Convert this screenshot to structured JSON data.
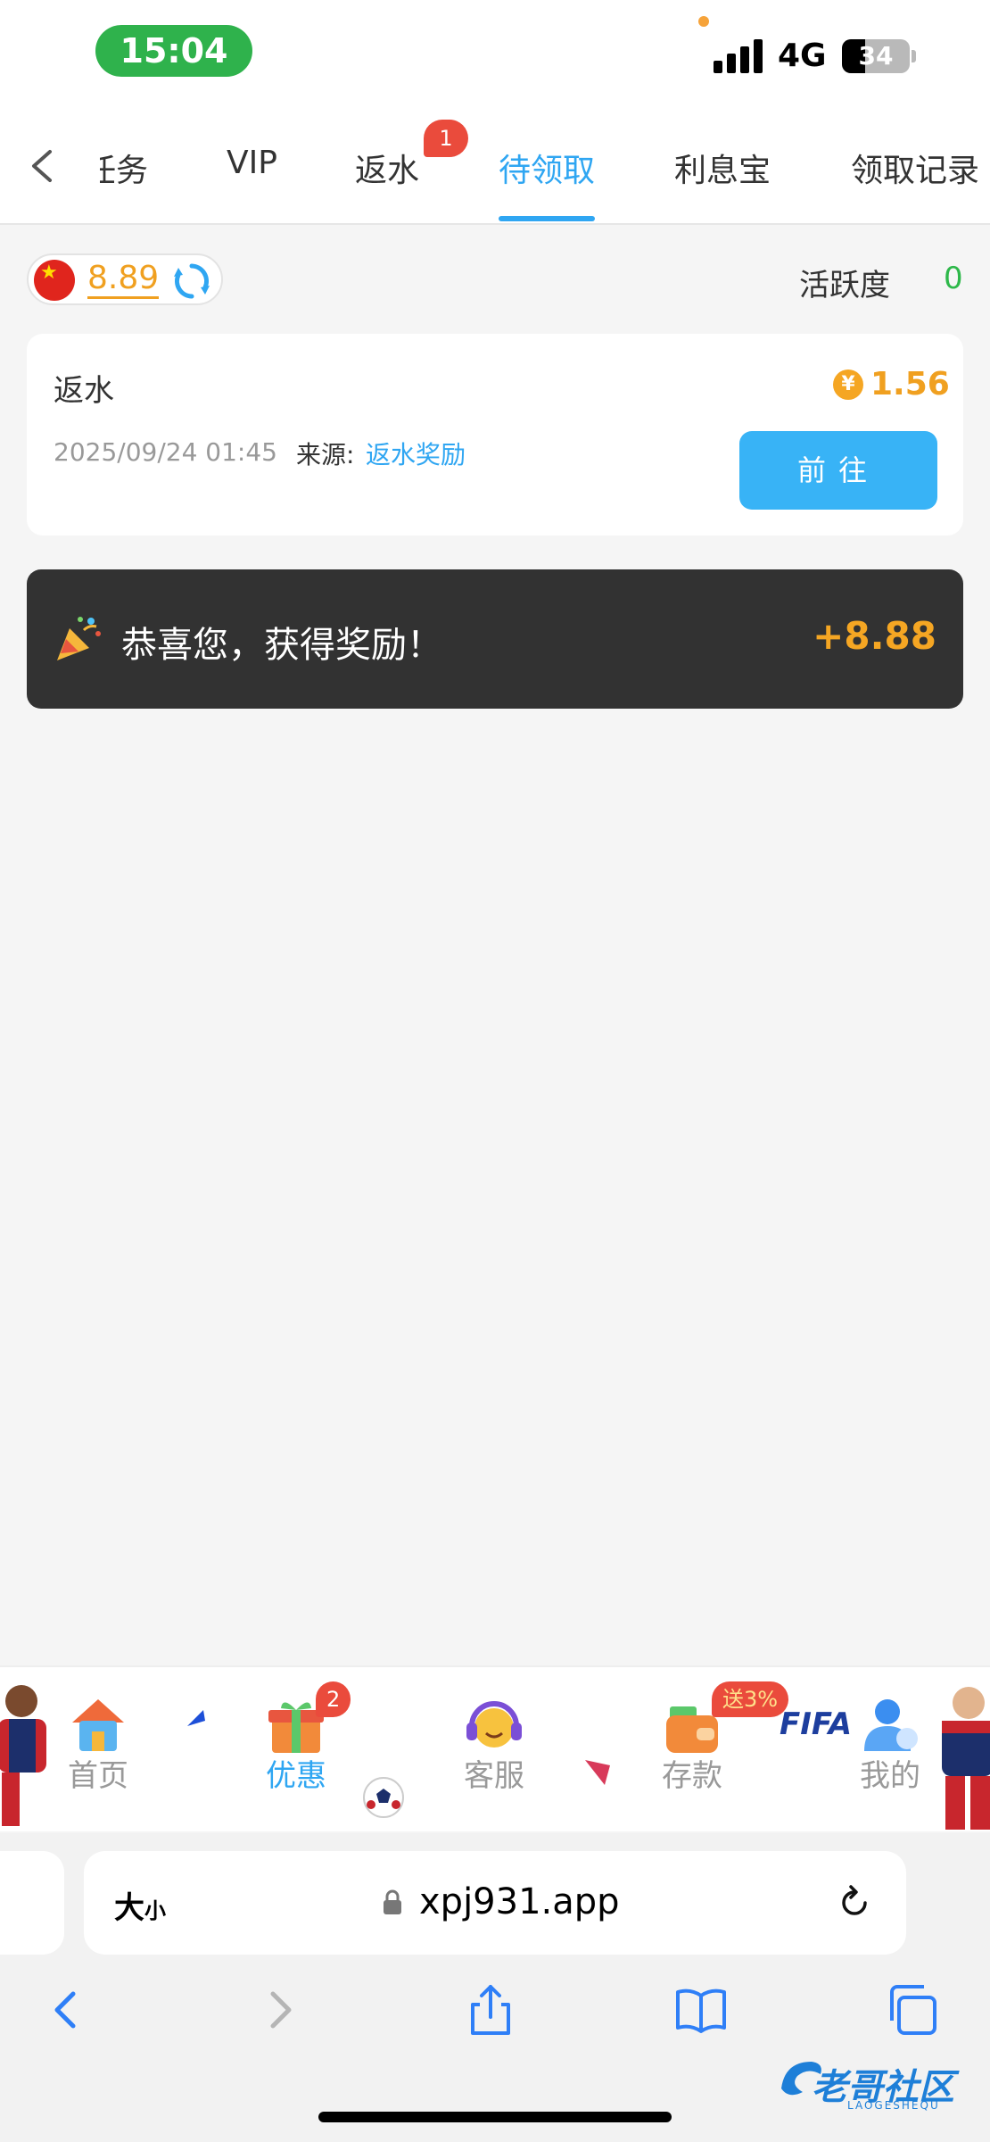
{
  "status_bar": {
    "time": "15:04",
    "network": "4G",
    "battery": "34",
    "battery_level_percent": 34,
    "signal_bars": 4
  },
  "tabs": [
    {
      "label": "任务",
      "visible_text": "任务",
      "active": false
    },
    {
      "label": "VIP",
      "active": false
    },
    {
      "label": "返水",
      "active": false,
      "badge": "1"
    },
    {
      "label": "待领取",
      "active": true
    },
    {
      "label": "利息宝",
      "active": false
    },
    {
      "label": "领取记录",
      "active": false
    }
  ],
  "balance": {
    "currency_flag": "china-flag-icon",
    "value": "8.89"
  },
  "activity": {
    "label": "活跃度",
    "value": "0"
  },
  "reward_card": {
    "title": "返水",
    "amount": "1.56",
    "coin_symbol": "¥",
    "date": "2025/09/24 01:45",
    "source_label": "来源:",
    "source_value": "返水奖励",
    "button_label": "前往"
  },
  "toast": {
    "message": "恭喜您，获得奖励！",
    "amount": "+8.88"
  },
  "bottom_nav": {
    "items": [
      {
        "label": "首页",
        "icon": "home-icon",
        "active": false
      },
      {
        "label": "优惠",
        "icon": "gift-icon",
        "active": true,
        "badge": "2"
      },
      {
        "label": "客服",
        "icon": "headset-icon",
        "active": false
      },
      {
        "label": "存款",
        "icon": "wallet-icon",
        "active": false,
        "badge": "送3%"
      },
      {
        "label": "我的",
        "icon": "user-icon",
        "active": false
      }
    ],
    "decoration": "FIFA"
  },
  "browser": {
    "text_size_label": "大",
    "text_size_small": "小",
    "url": "xpj931.app"
  },
  "watermark": {
    "text": "老哥社区",
    "sub": "LAOGESHEQU"
  },
  "colors": {
    "accent": "#2fa6f2",
    "amount": "#f0a020",
    "badge": "#ea4b3c",
    "toast_bg": "#323232",
    "success": "#2eb84a"
  }
}
